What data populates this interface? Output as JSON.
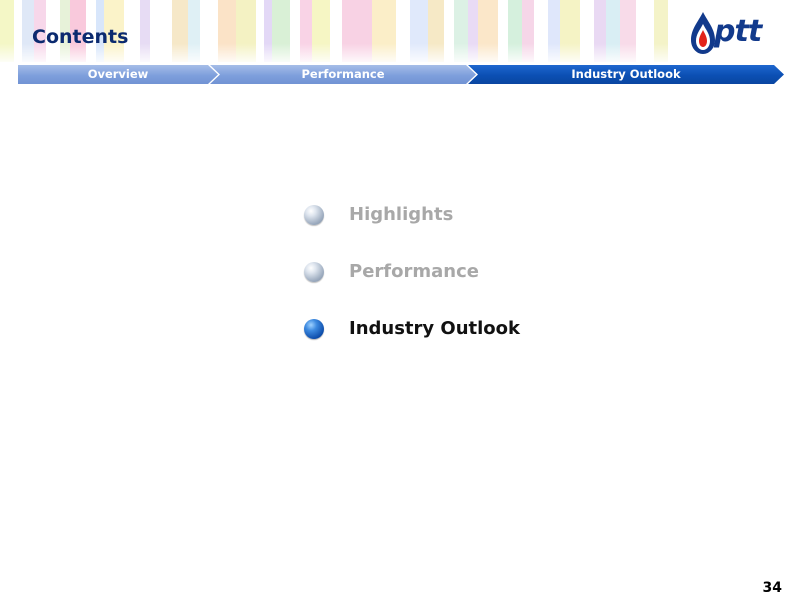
{
  "header": {
    "title": "Contents",
    "logo_text": "ptt"
  },
  "nav": {
    "items": [
      {
        "label": "Overview",
        "active": false
      },
      {
        "label": "Performance",
        "active": false
      },
      {
        "label": "Industry Outlook",
        "active": true
      }
    ]
  },
  "agenda": {
    "items": [
      {
        "label": "Highlights",
        "active": false
      },
      {
        "label": "Performance",
        "active": false
      },
      {
        "label": "Industry Outlook",
        "active": true
      }
    ]
  },
  "footer": {
    "page_number": "34"
  },
  "colors": {
    "title": "#0b2a6f",
    "nav_inactive": "#7e9fdc",
    "nav_active": "#0b4fb3",
    "agenda_inactive": "#a8a8a8",
    "agenda_active": "#111111",
    "logo_red": "#e2231a",
    "logo_blue": "#123a8c"
  }
}
